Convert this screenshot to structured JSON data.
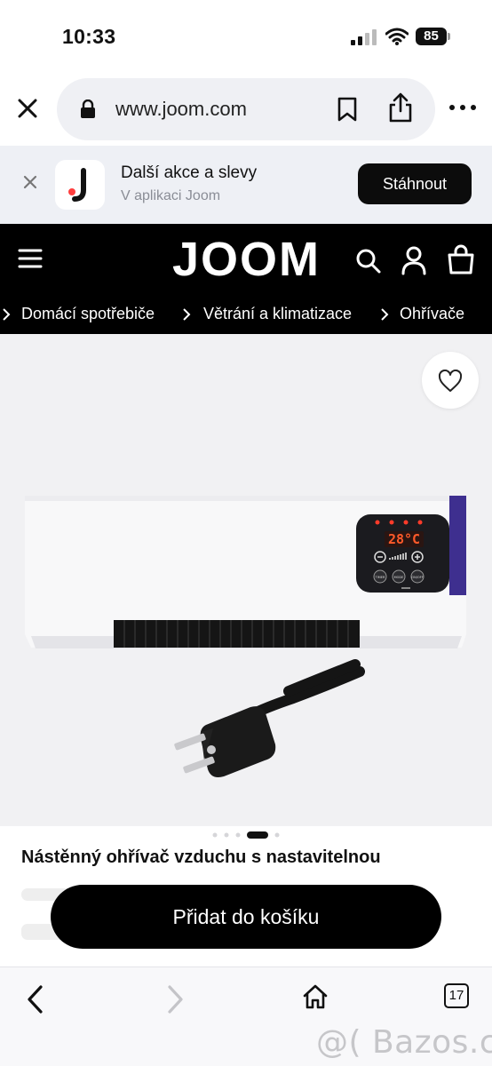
{
  "status_bar": {
    "time": "10:33",
    "battery_level": "85",
    "icons": [
      "signal-icon",
      "wifi-icon",
      "battery-icon"
    ]
  },
  "browser": {
    "url": "www.joom.com",
    "icons": [
      "close-icon",
      "lock-icon",
      "bookmark-icon",
      "share-icon",
      "more-icon"
    ],
    "tab_count": "17"
  },
  "app_banner": {
    "title": "Další akce a slevy",
    "subtitle": "V aplikaci Joom",
    "button_label": "Stáhnout"
  },
  "site_header": {
    "logo": "JOOM",
    "icons": [
      "menu-icon",
      "search-icon",
      "user-icon",
      "bag-icon"
    ]
  },
  "breadcrumb": [
    {
      "label": "Domácí spotřebiče"
    },
    {
      "label": "Větrání a klimatizace"
    },
    {
      "label": "Ohřívače"
    }
  ],
  "product": {
    "image_display": {
      "temperature": "28°C",
      "button_labels": [
        "TIMER",
        "MODE",
        "ON/OFF"
      ]
    },
    "gallery": {
      "count": 5,
      "active_index": 3
    },
    "title": "Nástěnný ohřívač vzduchu s nastavitelnou"
  },
  "cta": {
    "add_to_cart_label": "Přidat do košíku"
  },
  "watermark": "@( Bazos.cz",
  "colors": {
    "header_bg": "#000000",
    "accent_purple": "#3e2f8f",
    "display_red": "#ff5a2a"
  }
}
